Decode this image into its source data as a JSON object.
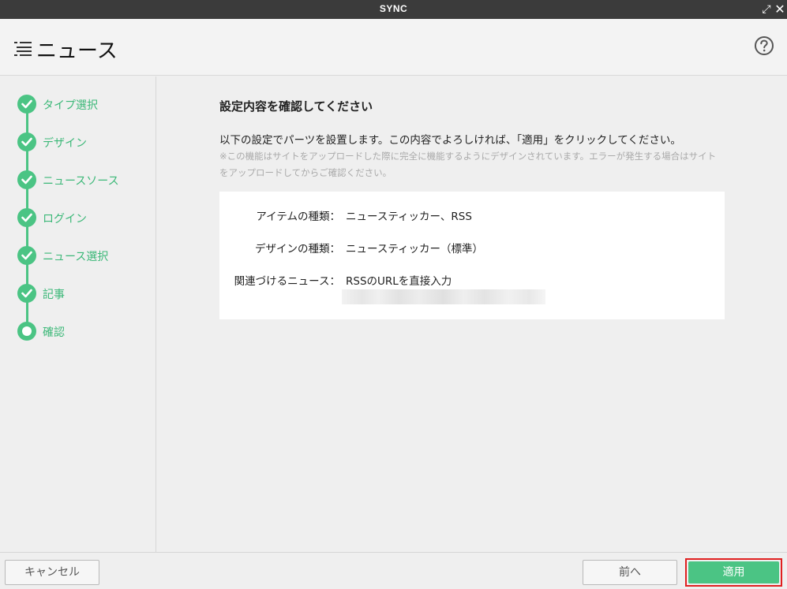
{
  "window": {
    "title": "SYNC",
    "expand_icon": "expand-arrows-icon",
    "close_icon": "close-icon"
  },
  "header": {
    "title": "ニュース",
    "menu_icon": "list-menu-icon",
    "help_icon": "help-circle-icon"
  },
  "steps": [
    {
      "label": "タイプ選択",
      "state": "done"
    },
    {
      "label": "デザイン",
      "state": "done"
    },
    {
      "label": "ニュースソース",
      "state": "done"
    },
    {
      "label": "ログイン",
      "state": "done"
    },
    {
      "label": "ニュース選択",
      "state": "done"
    },
    {
      "label": "記事",
      "state": "done"
    },
    {
      "label": "確認",
      "state": "current"
    }
  ],
  "main": {
    "heading": "設定内容を確認してください",
    "description": "以下の設定でパーツを設置します。この内容でよろしければ、「適用」をクリックしてください。",
    "note": "※この機能はサイトをアップロードした際に完全に機能するようにデザインされています。エラーが発生する場合はサイトをアップロードしてからご確認ください。",
    "summary": [
      {
        "key": "アイテムの種類：",
        "value": "ニュースティッカー、RSS"
      },
      {
        "key": "デザインの種類：",
        "value": "ニュースティッカー（標準）"
      },
      {
        "key": "関連づけるニュース：",
        "value": "RSSのURLを直接入力"
      }
    ]
  },
  "footer": {
    "cancel": "キャンセル",
    "prev": "前へ",
    "apply": "適用"
  },
  "colors": {
    "accent": "#4bc484",
    "highlight": "#e02020",
    "titlebar": "#3b3b3b"
  }
}
